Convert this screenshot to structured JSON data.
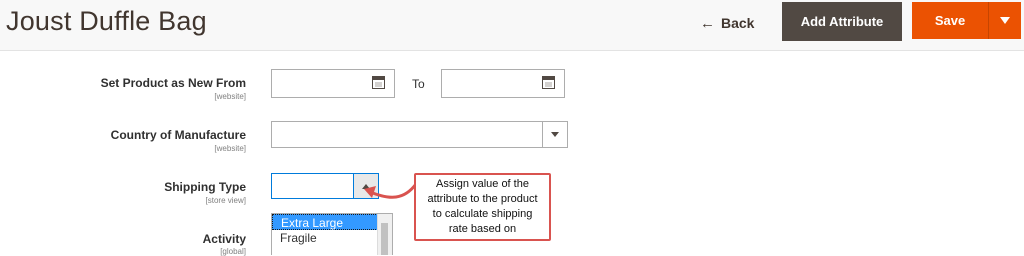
{
  "header": {
    "title": "Joust Duffle Bag",
    "back_label": "Back",
    "add_attribute_label": "Add Attribute",
    "save_label": "Save"
  },
  "form": {
    "new_from": {
      "label": "Set Product as New From",
      "scope": "[website]",
      "to_label": "To"
    },
    "country": {
      "label": "Country of Manufacture",
      "scope": "[website]"
    },
    "shipping": {
      "label": "Shipping Type",
      "scope": "[store view]",
      "options": [
        "Extra Large",
        "Fragile"
      ],
      "selected": "Extra Large"
    },
    "activity": {
      "label": "Activity",
      "scope": "[global]"
    }
  },
  "callout": {
    "text": "Assign value of the attribute to the product to calculate shipping rate based on"
  },
  "colors": {
    "save": "#eb5202",
    "add_attribute": "#514943",
    "callout_border": "#d9534f",
    "selected_option": "#3399ff"
  }
}
